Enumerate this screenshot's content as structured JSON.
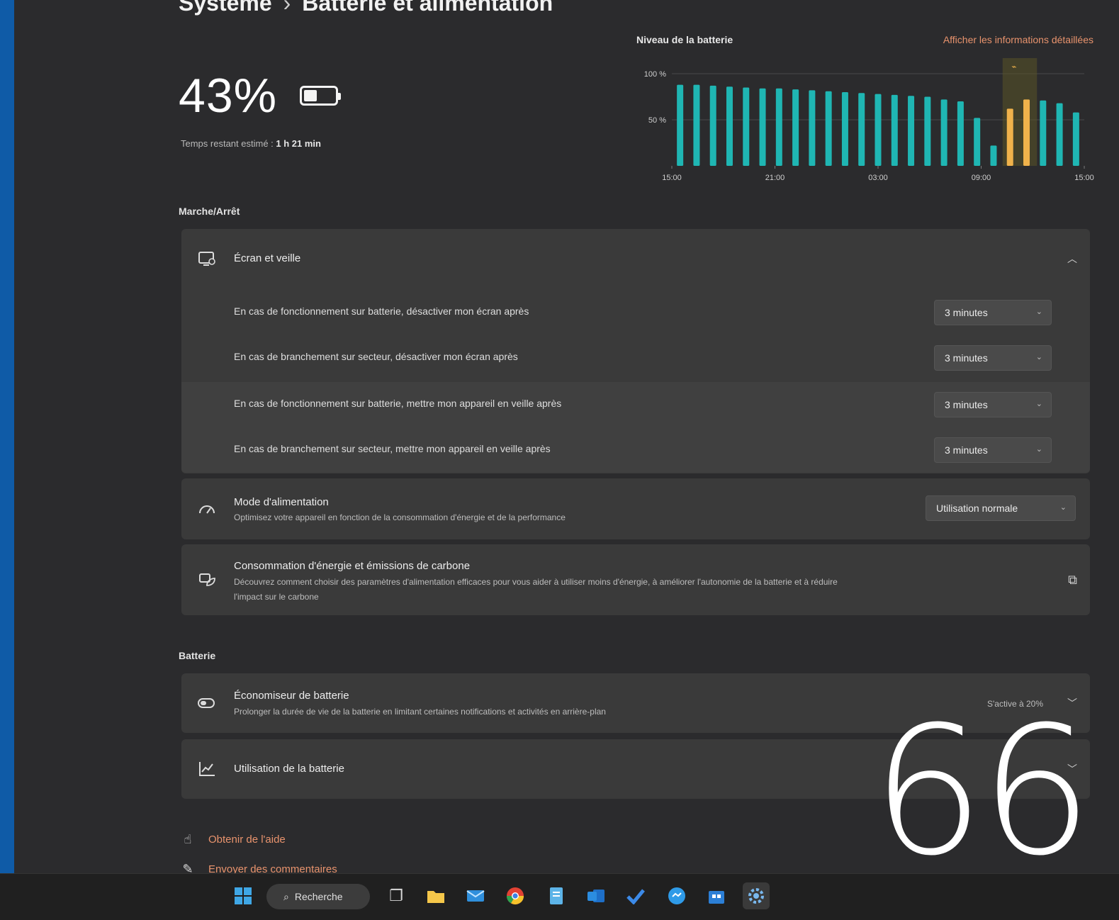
{
  "breadcrumb": {
    "parent": "Système",
    "separator": "›",
    "current": "Batterie et alimentation"
  },
  "battery": {
    "percent_label": "43%",
    "percent_value": 43,
    "remaining_prefix": "Temps restant estimé :",
    "remaining_value": "1 h 21 min"
  },
  "chart_link": "Afficher les informations détaillées",
  "chart_data": {
    "type": "bar",
    "title": "Niveau de la batterie",
    "y_tick_labels": [
      "100 %",
      "50 %"
    ],
    "x_tick_labels": [
      "15:00",
      "21:00",
      "03:00",
      "09:00",
      "15:00"
    ],
    "ylim": [
      0,
      100
    ],
    "values": [
      88,
      88,
      87,
      86,
      85,
      84,
      84,
      83,
      82,
      81,
      80,
      79,
      78,
      77,
      76,
      75,
      72,
      70,
      52,
      22,
      62,
      72,
      71,
      68,
      58
    ],
    "charging_flags": [
      false,
      false,
      false,
      false,
      false,
      false,
      false,
      false,
      false,
      false,
      false,
      false,
      false,
      false,
      false,
      false,
      false,
      false,
      false,
      false,
      true,
      true,
      false,
      false,
      false
    ],
    "colors": {
      "discharge": "#1fb6b3",
      "charge": "#f0b24b",
      "highlight_band": "#5a5427"
    }
  },
  "power_section": {
    "label": "Marche/Arrêt",
    "screen_sleep": {
      "title": "Écran et veille",
      "rows": [
        {
          "label": "En cas de fonctionnement sur batterie, désactiver mon écran après",
          "value": "3 minutes"
        },
        {
          "label": "En cas de branchement sur secteur, désactiver mon écran après",
          "value": "3 minutes"
        },
        {
          "label": "En cas de fonctionnement sur batterie, mettre mon appareil en veille après",
          "value": "3 minutes"
        },
        {
          "label": "En cas de branchement sur secteur, mettre mon appareil en veille après",
          "value": "3 minutes"
        }
      ]
    },
    "power_mode": {
      "title": "Mode d'alimentation",
      "description": "Optimisez votre appareil en fonction de la consommation d'énergie et de la performance",
      "value": "Utilisation normale"
    },
    "energy": {
      "title": "Consommation d'énergie et émissions de carbone",
      "description_line1": "Découvrez comment choisir des paramètres d'alimentation efficaces pour vous aider à utiliser moins d'énergie, à améliorer l'autonomie de la batterie et à réduire",
      "description_line2": "l'impact sur le carbone"
    }
  },
  "battery_section": {
    "label": "Batterie",
    "saver": {
      "title": "Économiseur de batterie",
      "description": "Prolonger la durée de vie de la batterie en limitant certaines notifications et activités en arrière-plan",
      "status": "S'active à 20%"
    },
    "usage": {
      "title": "Utilisation de la batterie"
    }
  },
  "footer_links": {
    "help": "Obtenir de l'aide",
    "feedback": "Envoyer des commentaires"
  },
  "overlay_number": "66",
  "taskbar": {
    "search_label": "Recherche"
  }
}
